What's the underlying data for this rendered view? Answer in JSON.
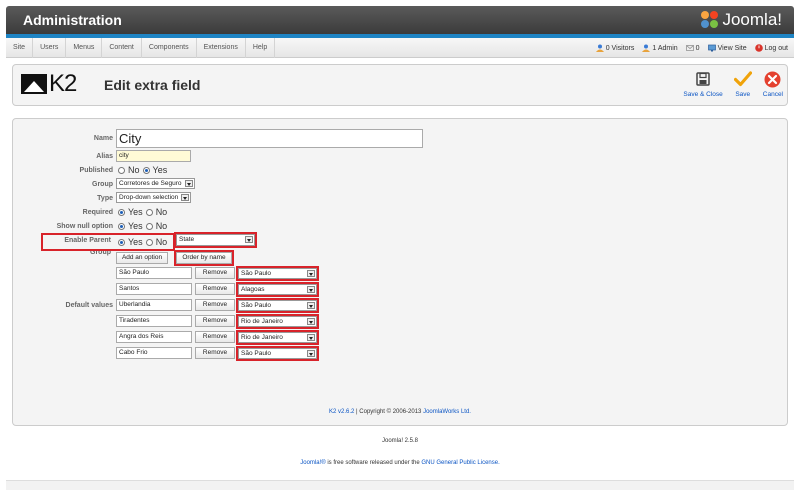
{
  "header": {
    "title": "Administration",
    "logo_text": "Joomla!"
  },
  "menu": [
    "Site",
    "Users",
    "Menus",
    "Content",
    "Components",
    "Extensions",
    "Help"
  ],
  "status": {
    "visitors": "0 Visitors",
    "admin": "1 Admin",
    "messages": "0",
    "view_site": "View Site",
    "logout": "Log out"
  },
  "toolbar": {
    "k2_text": "K2",
    "page_title": "Edit extra field",
    "save_close": "Save & Close",
    "save": "Save",
    "cancel": "Cancel"
  },
  "form": {
    "name_label": "Name",
    "name_value": "City",
    "alias_label": "Alias",
    "alias_value": "city",
    "published_label": "Published",
    "no": "No",
    "yes": "Yes",
    "group_label": "Group",
    "group_value": "Corretores de Seguro",
    "type_label": "Type",
    "type_value": "Drop-down selection",
    "required_label": "Required",
    "show_null_label": "Show null option",
    "enable_parent_label": "Enable Parent Group",
    "parent_value": "State",
    "add_option": "Add an option",
    "order_by_name": "Order by name",
    "default_values_label": "Default values",
    "remove": "Remove",
    "options": [
      {
        "value": "São Paulo",
        "parent": "São Paulo"
      },
      {
        "value": "Santos",
        "parent": "Alagoas"
      },
      {
        "value": "Uberlandia",
        "parent": "São Paulo"
      },
      {
        "value": "Tiradentes",
        "parent": "Rio de Janeiro"
      },
      {
        "value": "Angra dos Reis",
        "parent": "Rio de Janeiro"
      },
      {
        "value": "Cabo Frio",
        "parent": "São Paulo"
      }
    ]
  },
  "footer": {
    "k2_version": "K2 v2.6.2",
    "k2_copyright": " | Copyright © 2006-2013 ",
    "k2_company": "JoomlaWorks Ltd.",
    "joomla_version": "Joomla! 2.5.8",
    "joomla_link": "Joomla!®",
    "license_text": " is free software released under the ",
    "license_link": "GNU General Public License."
  }
}
